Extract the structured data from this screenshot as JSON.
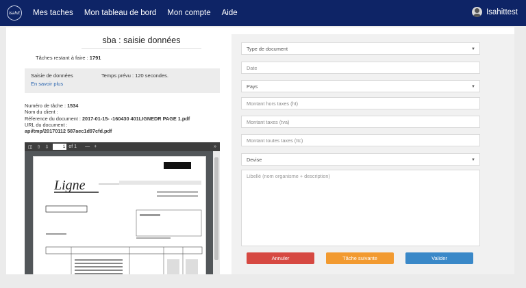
{
  "app": {
    "logo_text": "isahit"
  },
  "nav": {
    "items": [
      "Mes taches",
      "Mon tableau de bord",
      "Mon compte",
      "Aide"
    ]
  },
  "user": {
    "name": "Isahittest"
  },
  "task": {
    "title": "sba : saisie données",
    "remaining_label": "Tâches restant à faire :",
    "remaining_value": "1791",
    "type_label": "Saisie de données",
    "time_label": "Temps prévu : 120 secondes.",
    "learn_more": "En savoir plus",
    "number_label": "Numéro de tâche :",
    "number_value": "1534",
    "client_label": "Nom du client :",
    "client_value": "",
    "ref_label": "Réference du document :",
    "ref_value": "2017-01-15-       -160430 401LIGNEDR PAGE 1.pdf",
    "url_label": "URL du document :",
    "url_value": "api/tmp/20170112           587aec1d97cfd.pdf"
  },
  "viewer": {
    "page_input": "1",
    "page_total": "of 1"
  },
  "form": {
    "type_document": "Type de document",
    "date": "Date",
    "pays": "Pays",
    "montant_ht": "Montant hors taxes (ht)",
    "montant_tva": "Montant taxes (tva)",
    "montant_ttc": "Montant toutes taxes (ttc)",
    "devise": "Devise",
    "libelle": "Libellé (nom organisme + description)"
  },
  "buttons": {
    "cancel": "Annuler",
    "next": "Tâche suivante",
    "validate": "Valider"
  },
  "colors": {
    "nav_bg": "#0e2466",
    "cancel": "#d64942",
    "next": "#f29a30",
    "validate": "#3a88c8"
  }
}
